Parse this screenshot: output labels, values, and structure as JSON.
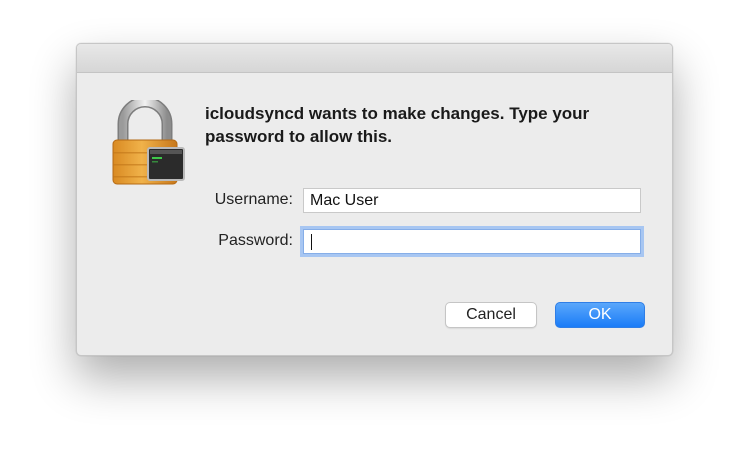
{
  "dialog": {
    "message_line1": "icloudsyncd wants to make changes. Type your",
    "message_line2": "password to allow this.",
    "username_label": "Username:",
    "username_value": "Mac User",
    "password_label": "Password:",
    "password_value": "",
    "cancel_label": "Cancel",
    "ok_label": "OK",
    "lock_icon": "padlock-terminal-icon"
  },
  "colors": {
    "accent": "#1a7cf7",
    "focus_ring": "#a7c6f2",
    "dialog_bg": "#ececec",
    "lock_gold": "#e6a23a"
  }
}
